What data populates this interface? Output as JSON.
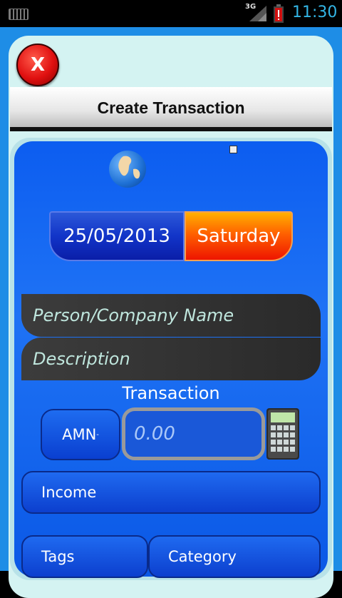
{
  "status_bar": {
    "network": "3G",
    "time": "11:30",
    "icons": [
      "keyboard-icon",
      "signal-icon",
      "battery-alert-icon"
    ]
  },
  "app": {
    "close_label": "X",
    "title": "Create Transaction"
  },
  "form": {
    "date": "25/05/2013",
    "day": "Saturday",
    "person_placeholder": "Person/Company Name",
    "description_placeholder": "Description",
    "transaction_label": "Transaction",
    "currency_label": "AMN",
    "amount_placeholder": "0.00",
    "type_label": "Income",
    "tags_label": "Tags",
    "category_label": "Category"
  },
  "colors": {
    "background_blue": "#1e8de6",
    "card_blue": "#0c5df0",
    "close_red": "#e01010",
    "day_orange": "#ff6000",
    "status_time": "#33b5e5"
  }
}
